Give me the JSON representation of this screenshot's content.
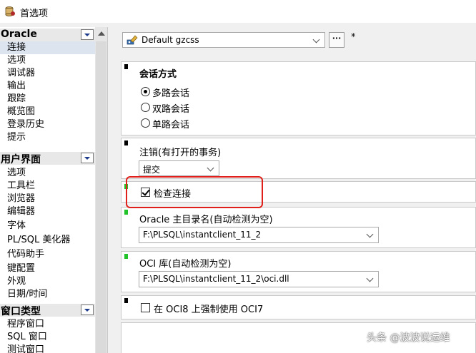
{
  "window": {
    "title": "首选项"
  },
  "sidebar": {
    "groups": [
      {
        "label": "Oracle",
        "items": [
          "连接",
          "选项",
          "调试器",
          "输出",
          "跟踪",
          "概览图",
          "登录历史",
          "提示"
        ]
      },
      {
        "label": "用户界面",
        "items": [
          "选项",
          "工具栏",
          "浏览器",
          "编辑器",
          "字体",
          "PL/SQL 美化器",
          "代码助手",
          "键配置",
          "外观",
          "日期/时间"
        ]
      },
      {
        "label": "窗口类型",
        "items": [
          "程序窗口",
          "SQL 窗口",
          "测试窗口"
        ]
      }
    ],
    "selected": "连接"
  },
  "toolbar": {
    "profile": "Default gzcss",
    "more_label": "···",
    "modified_marker": "*"
  },
  "sessions": {
    "heading": "会话方式",
    "options": [
      {
        "label": "多路会话",
        "checked": true
      },
      {
        "label": "双路会话",
        "checked": false
      },
      {
        "label": "单路会话",
        "checked": false
      }
    ]
  },
  "logout": {
    "label": "注销(有打开的事务)",
    "value": "提交"
  },
  "check_connection": {
    "label": "检查连接",
    "checked": true
  },
  "oracle_home": {
    "label": "Oracle 主目录名(自动检测为空)",
    "value": "F:\\PLSQL\\instantclient_11_2"
  },
  "oci_library": {
    "label": "OCI 库(自动检测为空)",
    "value": "F:\\PLSQL\\instantclient_11_2\\oci.dll"
  },
  "force_oci7": {
    "label": "在 OCI8 上强制使用 OCI7",
    "checked": false
  },
  "watermark": "头条 @波波说运维",
  "colors": {
    "highlight": "#e0201a",
    "marker_green": "#22c22a",
    "selected_bg": "#dce4f0"
  },
  "icons": {
    "title": "database-preferences-icon",
    "profile": "connection-profile-icon"
  }
}
